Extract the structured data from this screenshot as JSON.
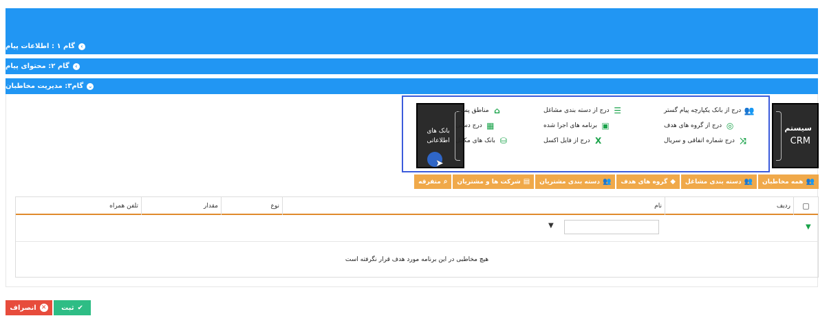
{
  "steps": [
    {
      "label": "گام ۱ : اطلاعات پیام"
    },
    {
      "label": "گام ۲: محتوای پیام"
    },
    {
      "label": "گام۳: مدیریت مخاطبان"
    }
  ],
  "crm": {
    "line1": "سیستم",
    "line2": "CRM"
  },
  "bank": {
    "label": "بانک های اطلاعاتی"
  },
  "options": {
    "col_right": [
      {
        "label": "درج از بانک یکپارچه پیام گستر",
        "icon": "users-icon"
      },
      {
        "label": "درج از گروه های هدف",
        "icon": "target-icon"
      },
      {
        "label": "درج شماره اتفاقی و سریال",
        "icon": "shuffle-icon"
      }
    ],
    "col_mid": [
      {
        "label": "درج از دسته بندی مشاغل",
        "icon": "list-icon"
      },
      {
        "label": "برنامه های اجرا شده",
        "icon": "save-icon"
      },
      {
        "label": "درج از فایل اکسل",
        "icon": "excel-icon"
      }
    ],
    "col_left": [
      {
        "label": "مناطق پستی",
        "icon": "location-icon"
      },
      {
        "label": "درج دستی",
        "icon": "keyboard-icon"
      },
      {
        "label": "بانک های مکمل",
        "icon": "database-icon"
      }
    ]
  },
  "tabs": [
    {
      "label": "همه مخاطبان",
      "icon": "users-icon"
    },
    {
      "label": "دسته بندی مشاغل",
      "icon": "users-icon"
    },
    {
      "label": "گروه های هدف",
      "icon": "diamond-icon"
    },
    {
      "label": "دسته بندی مشتریان",
      "icon": "users-icon"
    },
    {
      "label": "شرکت ها و مشتریان",
      "icon": "building-icon"
    },
    {
      "label": "متفرقه",
      "icon": "search-icon"
    }
  ],
  "table": {
    "headers": {
      "row": "ردیف",
      "name": "نام",
      "type": "نوع",
      "amount": "مقدار",
      "mobile": "تلفن همراه"
    },
    "filter_value": "",
    "empty_message": "هیچ مخاطبی در این برنامه مورد هدف قرار نگرفته است"
  },
  "buttons": {
    "save": "ثبت",
    "cancel": "انصراف"
  },
  "colors": {
    "primary": "#2196f3",
    "tab": "#f0a94a",
    "success": "#2ebd85",
    "danger": "#e74c3c",
    "icon_green": "#1aa34a"
  }
}
